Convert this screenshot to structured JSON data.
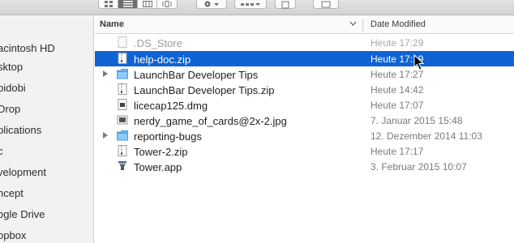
{
  "toolbar": {
    "view_buttons": [
      "icon-view",
      "list-view",
      "column-view",
      "coverflow-view"
    ],
    "active_view": "list-view",
    "icons": [
      "gear-icon",
      "arrange-icon",
      "share-icon",
      "tags-icon"
    ]
  },
  "sidebar": {
    "items": [
      {
        "label": "acintosh HD"
      },
      {
        "label": "sktop"
      },
      {
        "label": "bidobi"
      },
      {
        "label": "Drop"
      },
      {
        "label": "plications"
      },
      {
        "label": "c"
      },
      {
        "label": "velopment"
      },
      {
        "label": "ncept"
      },
      {
        "label": "ogle Drive"
      },
      {
        "label": "opbox"
      }
    ]
  },
  "columns": {
    "name": "Name",
    "date_modified": "Date Modified"
  },
  "files": [
    {
      "name": ".DS_Store",
      "date": "Heute 17:29",
      "icon": "document-icon",
      "folder": false,
      "selected": false,
      "dim": true
    },
    {
      "name": "help-doc.zip",
      "date": "Heute 17:19",
      "icon": "zip-icon",
      "folder": false,
      "selected": true,
      "dim": false
    },
    {
      "name": "LaunchBar Developer Tips",
      "date": "Heute 17:27",
      "icon": "folder-icon",
      "folder": true,
      "selected": false,
      "dim": false
    },
    {
      "name": "LaunchBar Developer Tips.zip",
      "date": "Heute 14:42",
      "icon": "zip-icon",
      "folder": false,
      "selected": false,
      "dim": false
    },
    {
      "name": "licecap125.dmg",
      "date": "Heute 17:07",
      "icon": "disk-image-icon",
      "folder": false,
      "selected": false,
      "dim": false
    },
    {
      "name": "nerdy_game_of_cards@2x-2.jpg",
      "date": "7. Januar 2015 15:48",
      "icon": "image-file-icon",
      "folder": false,
      "selected": false,
      "dim": false
    },
    {
      "name": "reporting-bugs",
      "date": "12. Dezember 2014 11:03",
      "icon": "folder-icon",
      "folder": true,
      "selected": false,
      "dim": false
    },
    {
      "name": "Tower-2.zip",
      "date": "Heute 17:17",
      "icon": "zip-icon",
      "folder": false,
      "selected": false,
      "dim": false
    },
    {
      "name": "Tower.app",
      "date": "3. Februar 2015 10:07",
      "icon": "app-icon",
      "folder": false,
      "selected": false,
      "dim": false
    }
  ],
  "colors": {
    "selection": "#0f63d3",
    "folder": "#5fb0f0",
    "sidebar_bg": "#f2f2f2"
  }
}
